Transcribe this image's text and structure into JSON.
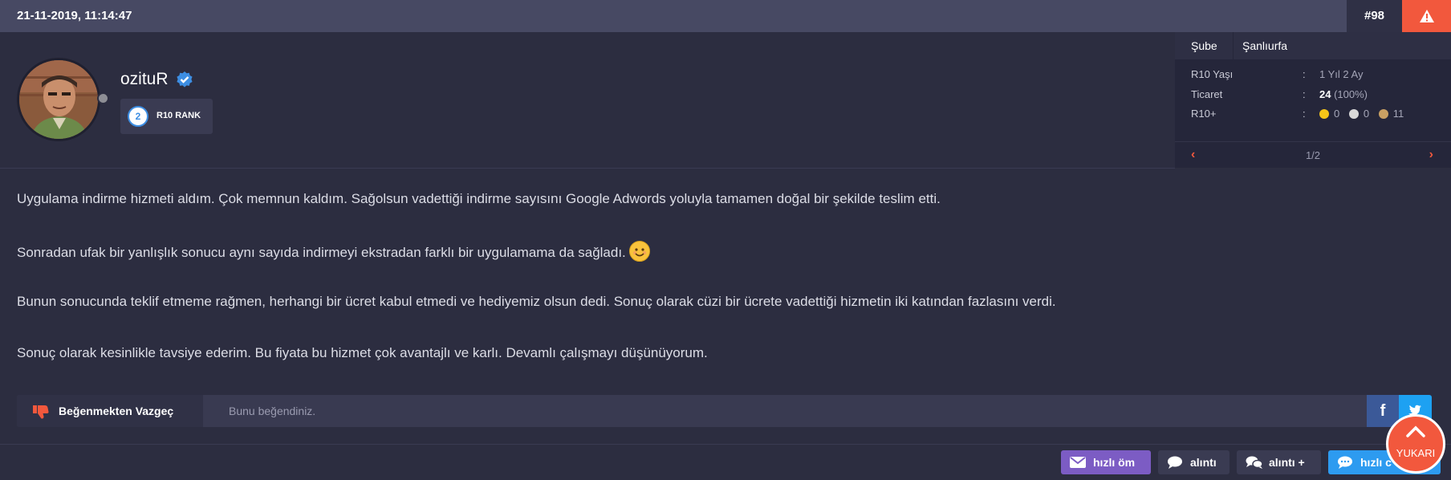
{
  "header": {
    "datetime": "21-11-2019, 11:14:47",
    "post_number": "#98",
    "report_icon": "warning-triangle-icon"
  },
  "user": {
    "username": "ozituR",
    "verified_icon": "verified-check-icon",
    "rank_number": "2",
    "rank_label": "R10 RANK",
    "status": "offline"
  },
  "info": {
    "branch_label": "Şube",
    "branch_value": "Şanlıurfa",
    "rows": [
      {
        "label": "R10 Yaşı",
        "colon": ":",
        "value": "1 Yıl 2 Ay"
      },
      {
        "label": "Ticaret",
        "colon": ":",
        "value_bold": "24",
        "value_rest": " (100%)"
      },
      {
        "label": "R10+",
        "colon": ":",
        "coins": [
          {
            "color": "#f5c518",
            "value": "0"
          },
          {
            "color": "#d9d9d9",
            "value": "0"
          },
          {
            "color": "#c9a063",
            "value": "11"
          }
        ]
      }
    ],
    "pager": {
      "current": "1/2",
      "prev_icon": "chevron-left-icon",
      "next_icon": "chevron-right-icon"
    }
  },
  "post": {
    "paragraphs": [
      "Uygulama indirme hizmeti aldım. Çok memnun kaldım. Sağolsun vadettiği indirme sayısını Google Adwords yoluyla tamamen doğal bir şekilde teslim etti.",
      "Sonradan ufak bir yanlışlık sonucu aynı sayıda indirmeyi ekstradan farklı bir uygulamama da sağladı.",
      "Bunun sonucunda teklif etmeme rağmen, herhangi bir ücret kabul etmedi ve hediyemiz olsun dedi. Sonuç olarak cüzi bir ücrete vadettiği hizmetin iki katından fazlasını verdi.",
      "Sonuç olarak kesinlikle tavsiye ederim. Bu fiyata bu hizmet çok avantajlı ve karlı. Devamlı çalışmayı düşünüyorum."
    ],
    "emoji": "smiling-face-emoji"
  },
  "likebar": {
    "unlike_label": "Beğenmekten Vazgeç",
    "liked_text": "Bunu beğendiniz.",
    "facebook_glyph": "f"
  },
  "actions": {
    "pm_label": "hızlı öm",
    "quote_label": "alıntı",
    "quote_plus_label": "alıntı +",
    "quick_reply_label": "hızlı c"
  },
  "scroll_top": {
    "label": "YUKARI"
  },
  "colors": {
    "accent": "#f2583d",
    "pm_purple": "#7c5cc4",
    "quick_blue": "#2d9bf0",
    "facebook": "#3b5998",
    "twitter": "#1da1f2"
  }
}
